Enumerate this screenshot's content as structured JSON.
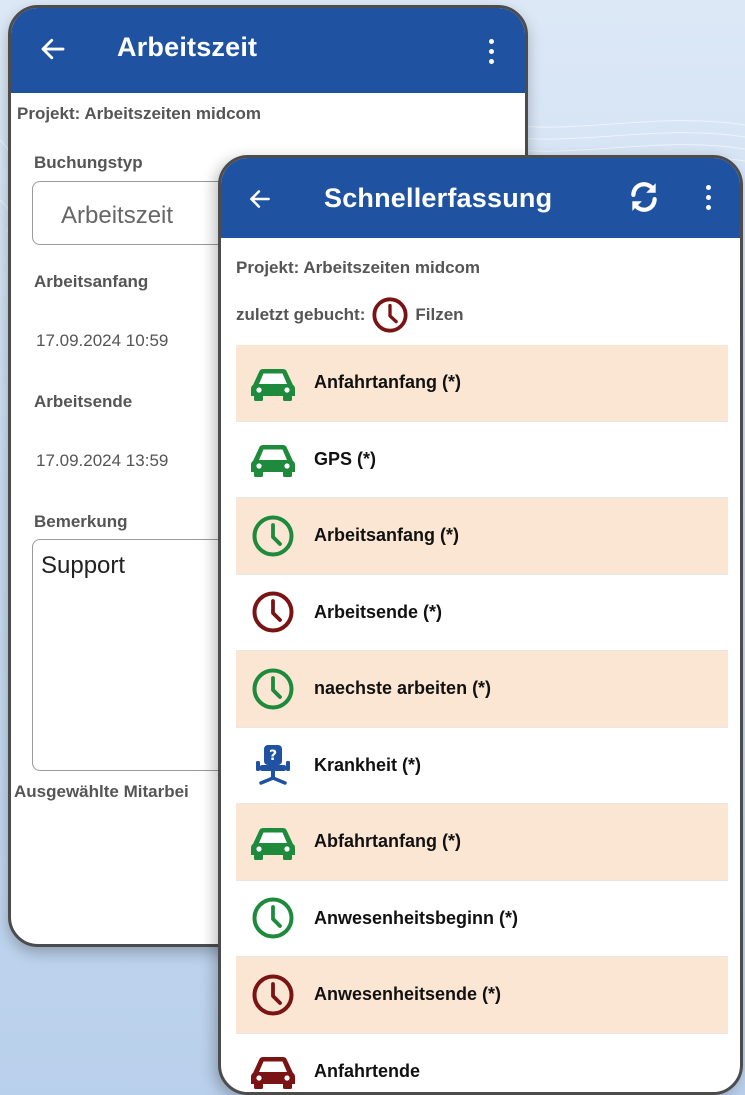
{
  "back_screen": {
    "title": "Arbeitszeit",
    "project": "Projekt: Arbeitszeiten midcom",
    "booking_type_label": "Buchungstyp",
    "booking_type_value": "Arbeitszeit",
    "start_label": "Arbeitsanfang",
    "start_value": "17.09.2024 10:59",
    "end_label": "Arbeitsende",
    "end_value": "17.09.2024 13:59",
    "remark_label": "Bemerkung",
    "remark_value": "Support",
    "employees_label": "Ausgewählte Mitarbei"
  },
  "front_screen": {
    "title": "Schnellerfassung",
    "project": "Projekt: Arbeitszeiten midcom",
    "last_booked_label": "zuletzt gebucht:",
    "last_booked_value": "Filzen",
    "items": [
      {
        "label": "Anfahrtanfang (*)",
        "icon": "car-icon",
        "color": "#1e8a3c",
        "tinted": true
      },
      {
        "label": "GPS (*)",
        "icon": "car-icon",
        "color": "#1e8a3c",
        "tinted": false
      },
      {
        "label": "Arbeitsanfang (*)",
        "icon": "clock-icon",
        "color": "#1e8a3c",
        "tinted": true
      },
      {
        "label": "Arbeitsende (*)",
        "icon": "clock-icon",
        "color": "#7a1414",
        "tinted": false
      },
      {
        "label": "naechste arbeiten (*)",
        "icon": "clock-icon",
        "color": "#1e8a3c",
        "tinted": true
      },
      {
        "label": "Krankheit (*)",
        "icon": "sick-chair-icon",
        "color": "#1f52a0",
        "tinted": false
      },
      {
        "label": "Abfahrtanfang (*)",
        "icon": "car-icon",
        "color": "#1e8a3c",
        "tinted": true
      },
      {
        "label": "Anwesenheitsbeginn (*)",
        "icon": "clock-icon",
        "color": "#1e8a3c",
        "tinted": false
      },
      {
        "label": "Anwesenheitsende (*)",
        "icon": "clock-icon",
        "color": "#7a1414",
        "tinted": true
      },
      {
        "label": "Anfahrtende",
        "icon": "car-icon",
        "color": "#7a1414",
        "tinted": false
      }
    ]
  },
  "colors": {
    "appbar": "#1f52a0",
    "row_tint": "#fbe6d3",
    "green": "#1e8a3c",
    "darkred": "#7a1414"
  }
}
